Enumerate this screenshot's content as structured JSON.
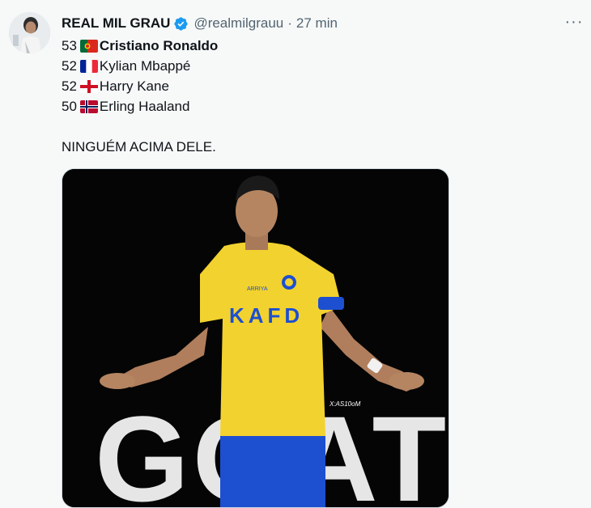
{
  "author": {
    "name": "REAL MIL GRAU",
    "handle": "@realmilgrauu",
    "separator": "·",
    "time": "27 min"
  },
  "more_label": "···",
  "tweet": {
    "rankings": [
      {
        "number": "53",
        "flag": "portugal-flag-icon",
        "player": "Cristiano Ronaldo",
        "bold": true
      },
      {
        "number": "52",
        "flag": "france-flag-icon",
        "player": "Kylian Mbappé",
        "bold": false
      },
      {
        "number": "52",
        "flag": "england-flag-icon",
        "player": "Harry Kane",
        "bold": false
      },
      {
        "number": "50",
        "flag": "norway-flag-icon",
        "player": "Erling Haaland",
        "bold": false
      }
    ],
    "closing": "NINGUÉM ACIMA DELE."
  },
  "media": {
    "jersey_text": "KAFD",
    "sponsor_text": "ARRIYA",
    "watermark": "X:AS10oM",
    "overlay_text": "GOAT"
  },
  "colors": {
    "verified": "#1d9bf0",
    "jersey": "#f2d22e",
    "shorts": "#1d4fd1"
  }
}
